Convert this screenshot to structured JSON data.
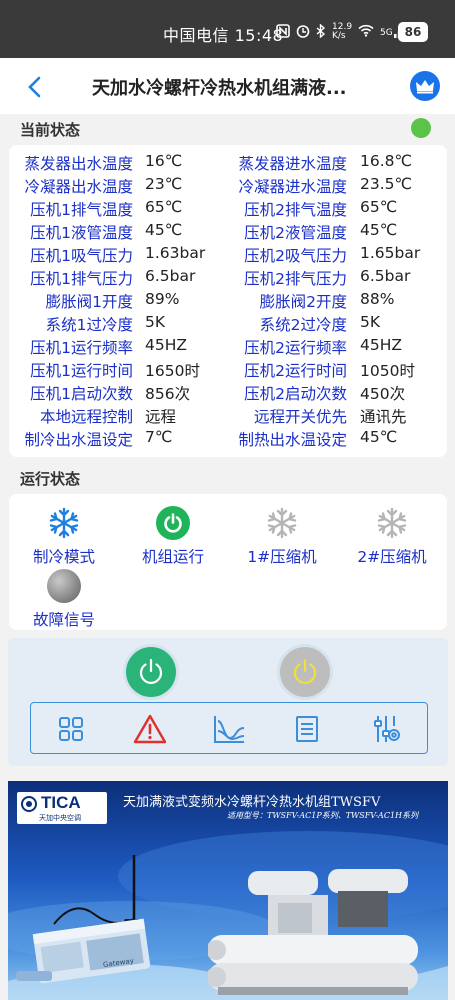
{
  "status_bar": {
    "carrier_time": "中国电信 15:48",
    "speed_value": "12.9",
    "speed_unit": "K/s",
    "network": "5G",
    "battery": "86"
  },
  "header": {
    "title": "天加水冷螺杆冷热水机组满液..."
  },
  "current_state": {
    "title": "当前状态",
    "indicator_color": "#5cc34a",
    "rows": [
      {
        "label1": "蒸发器出水温度",
        "value1": "16℃",
        "label2": "蒸发器进水温度",
        "value2": "16.8℃"
      },
      {
        "label1": "冷凝器出水温度",
        "value1": "23℃",
        "label2": "冷凝器进水温度",
        "value2": "23.5℃"
      },
      {
        "label1": "压机1排气温度",
        "value1": "65℃",
        "label2": "压机2排气温度",
        "value2": "65℃"
      },
      {
        "label1": "压机1液管温度",
        "value1": "45℃",
        "label2": "压机2液管温度",
        "value2": "45℃"
      },
      {
        "label1": "压机1吸气压力",
        "value1": "1.63bar",
        "label2": "压机2吸气压力",
        "value2": "1.65bar"
      },
      {
        "label1": "压机1排气压力",
        "value1": "6.5bar",
        "label2": "压机2排气压力",
        "value2": "6.5bar"
      },
      {
        "label1": "膨胀阀1开度",
        "value1": "89%",
        "label2": "膨胀阀2开度",
        "value2": "88%"
      },
      {
        "label1": "系统1过冷度",
        "value1": "5K",
        "label2": "系统2过冷度",
        "value2": "5K"
      },
      {
        "label1": "压机1运行频率",
        "value1": "45HZ",
        "label2": "压机2运行频率",
        "value2": "45HZ"
      },
      {
        "label1": "压机1运行时间",
        "value1": "1650时",
        "label2": "压机2运行时间",
        "value2": "1050时"
      },
      {
        "label1": "压机1启动次数",
        "value1": "856次",
        "label2": "压机2启动次数",
        "value2": "450次"
      },
      {
        "label1": "本地远程控制",
        "value1": "远程",
        "label2": "远程开关优先",
        "value2": "通讯先"
      },
      {
        "label1": "制冷出水温设定",
        "value1": "7℃",
        "label2": "制热出水温设定",
        "value2": "45℃"
      }
    ]
  },
  "run_state": {
    "title": "运行状态",
    "items": [
      {
        "label": "制冷模式",
        "icon": "snowflake-icon",
        "color": "#1d7fe0"
      },
      {
        "label": "机组运行",
        "icon": "power-icon",
        "color": "#1fb35a"
      },
      {
        "label": "1#压缩机",
        "icon": "snowflake-icon",
        "color": "#b5b5b5"
      },
      {
        "label": "2#压缩机",
        "icon": "snowflake-icon",
        "color": "#b5b5b5"
      },
      {
        "label": "故障信号",
        "icon": "fault-indicator-icon",
        "color": "#888888"
      }
    ]
  },
  "controls": {
    "power_on_color": "#2ab47a",
    "power_off_color": "#bdbdbd",
    "tools": [
      "grid-icon",
      "warning-icon",
      "curve-chart-icon",
      "list-icon",
      "settings-sliders-icon"
    ]
  },
  "banner": {
    "logo_text": "TICA",
    "logo_sub": "天加中央空调",
    "title": "天加满液式变频水冷螺杆冷热水机组TWSFV",
    "subtitle": "适用型号：TWSFV-AC1P系列、TWSFV-AC1H系列",
    "device_label": "Gateway"
  }
}
